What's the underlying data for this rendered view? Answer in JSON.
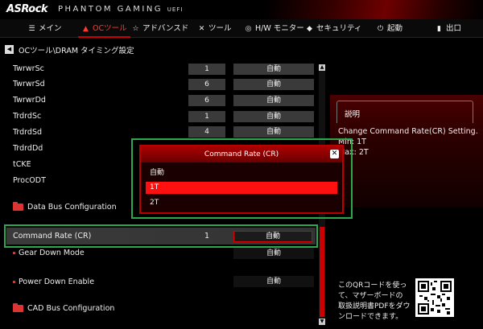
{
  "header": {
    "brand": "ASRock",
    "product": "PHANTOM GAMING",
    "uefi": "UEFI"
  },
  "nav": [
    {
      "label": "メイン",
      "icon": "list-icon"
    },
    {
      "label": "OCツール",
      "icon": "flame-icon",
      "active": true
    },
    {
      "label": "アドバンスド",
      "icon": "star-icon"
    },
    {
      "label": "ツール",
      "icon": "tools-icon"
    },
    {
      "label": "H/W モニター",
      "icon": "monitor-icon"
    },
    {
      "label": "セキュリティ",
      "icon": "shield-icon"
    },
    {
      "label": "起動",
      "icon": "power-icon"
    },
    {
      "label": "出口",
      "icon": "exit-icon"
    }
  ],
  "breadcrumb": "OCツール\\DRAM タイミング設定",
  "settings": [
    {
      "label": "TwrwrSc",
      "value": "1",
      "mode": "自動"
    },
    {
      "label": "TwrwrSd",
      "value": "6",
      "mode": "自動"
    },
    {
      "label": "TwrwrDd",
      "value": "6",
      "mode": "自動"
    },
    {
      "label": "TrdrdSc",
      "value": "1",
      "mode": "自動"
    },
    {
      "label": "TrdrdSd",
      "value": "4",
      "mode": "自動"
    },
    {
      "label": "TrdrdDd"
    },
    {
      "label": "tCKE"
    },
    {
      "label": "ProcODT"
    }
  ],
  "data_bus": "Data Bus Configuration",
  "command_rate": {
    "label": "Command Rate (CR)",
    "value": "1",
    "mode": "自動"
  },
  "gear_down": {
    "label": "Gear Down Mode",
    "mode": "自動"
  },
  "power_down": {
    "label": "Power Down Enable",
    "mode": "自動"
  },
  "cad_bus": "CAD Bus Configuration",
  "description": {
    "title": "説明",
    "lines": [
      "Change Command Rate(CR) Setting.",
      "Min: 1T",
      "Max: 2T"
    ]
  },
  "popup": {
    "title": "Command Rate (CR)",
    "options": [
      "自動",
      "1T",
      "2T"
    ],
    "selected": "1T"
  },
  "qr_text": [
    "このQRコードを使っ",
    "て、マザーボードの",
    "取扱説明書PDFをダウ",
    "ンロードできます。"
  ],
  "colors": {
    "accent": "#cc0000",
    "highlight": "#ff1010",
    "annotation": "#2ea84c"
  }
}
